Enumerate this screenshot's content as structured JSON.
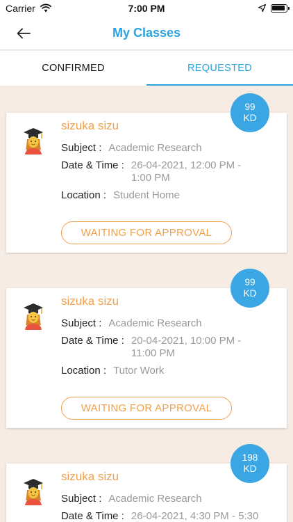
{
  "status_bar": {
    "carrier": "Carrier",
    "time": "7:00 PM"
  },
  "nav": {
    "title": "My Classes"
  },
  "tabs": [
    {
      "label": "CONFIRMED"
    },
    {
      "label": "REQUESTED"
    }
  ],
  "labels": {
    "subject": "Subject :",
    "datetime": "Date & Time :",
    "location": "Location :"
  },
  "classes": [
    {
      "price": "99",
      "currency": "KD",
      "tutor": "sizuka sizu",
      "subject": "Academic Research",
      "datetime": "26-04-2021, 12:00 PM - 1:00 PM",
      "location": "Student Home",
      "status": "WAITING FOR APPROVAL"
    },
    {
      "price": "99",
      "currency": "KD",
      "tutor": "sizuka sizu",
      "subject": "Academic Research",
      "datetime": "20-04-2021, 10:00 PM - 11:00 PM",
      "location": "Tutor Work",
      "status": "WAITING FOR APPROVAL"
    },
    {
      "price": "198",
      "currency": "KD",
      "tutor": "sizuka sizu",
      "subject": "Academic Research",
      "datetime": "26-04-2021, 4:30 PM - 5:30"
    }
  ],
  "colors": {
    "accent": "#2aa3dd",
    "badge": "#3aa6e4",
    "orange": "#f0a04b",
    "background": "#f6ece4"
  }
}
